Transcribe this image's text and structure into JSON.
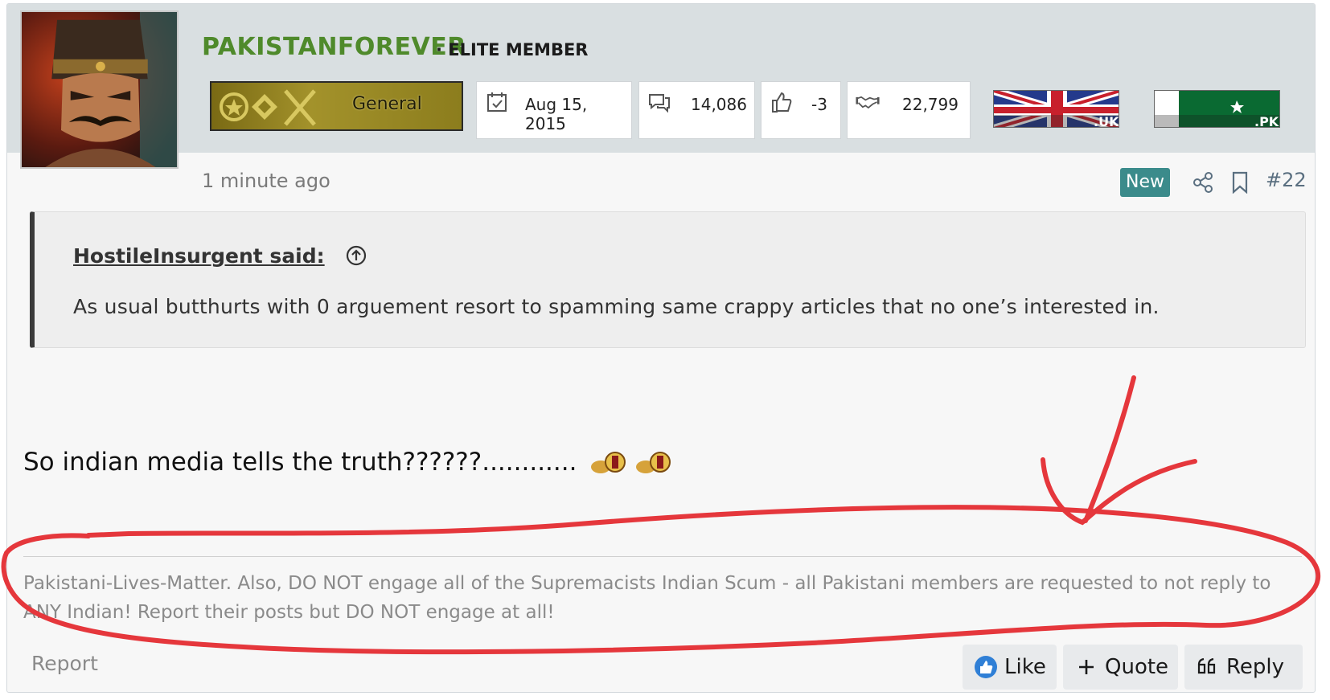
{
  "user": {
    "username": "PAKISTANFOREVER",
    "title_separator": "·",
    "title": "ELITE MEMBER",
    "rank": "General"
  },
  "stats": {
    "joined": "Aug 15, 2015",
    "messages": "14,086",
    "reactions": "-3",
    "points": "22,799"
  },
  "flags": [
    {
      "label": ".UK"
    },
    {
      "label": ".PK"
    }
  ],
  "post": {
    "time": "1 minute ago",
    "new_badge": "New",
    "number": "#22"
  },
  "quote": {
    "author": "HostileInsurgent said:",
    "text": "As usual butthurts with 0 arguement resort to spamming same crappy articles that no one’s interested in."
  },
  "message": "So indian media tells the truth??????............",
  "signature": "Pakistani-Lives-Matter. Also, DO NOT engage all of the Supremacists Indian Scum - all Pakistani members are requested to not reply to ANY Indian! Report their posts but DO NOT engage at all!",
  "actions": {
    "report": "Report",
    "like": "Like",
    "quote": "Quote",
    "reply": "Reply"
  },
  "colors": {
    "username": "#4f8a2b",
    "badge_new": "#3b8b8b",
    "annotation": "#e5373c"
  }
}
